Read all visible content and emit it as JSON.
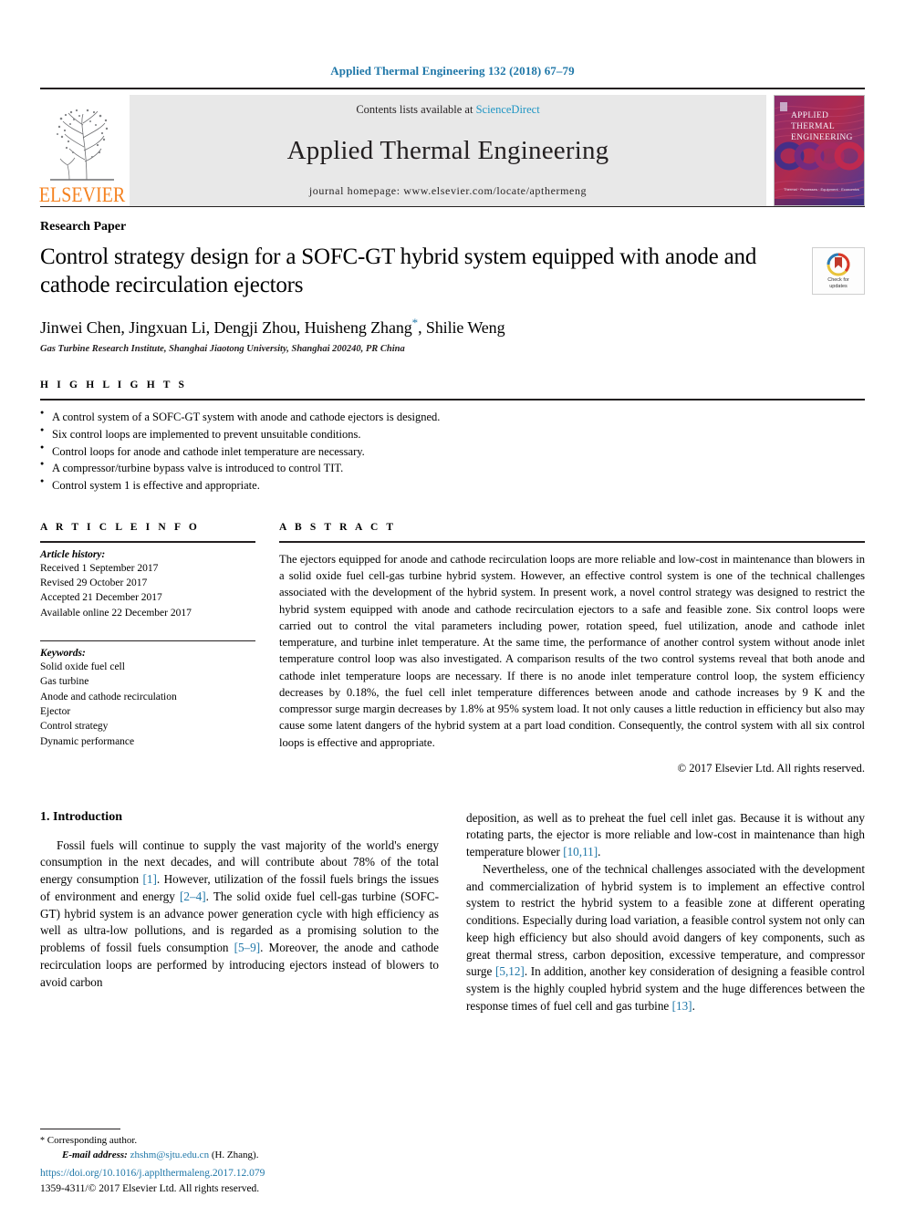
{
  "running_head": "Applied Thermal Engineering 132 (2018) 67–79",
  "masthead": {
    "publisher": "ELSEVIER",
    "contents_prefix": "Contents lists available at ",
    "contents_link": "ScienceDirect",
    "journal_title": "Applied Thermal Engineering",
    "homepage": "journal homepage: www.elsevier.com/locate/apthermeng",
    "cover_lines": [
      "APPLIED",
      "THERMAL",
      "ENGINEERING"
    ],
    "cover_footer": "Thermal · Processes · Equipment · Economics",
    "colors": {
      "link_blue": "#2196c4",
      "elsevier_orange": "#f58220",
      "band_gray": "#e8e8e8"
    }
  },
  "article": {
    "kind": "Research Paper",
    "title": "Control strategy design for a SOFC-GT hybrid system equipped with anode and cathode recirculation ejectors",
    "authors": "Jinwei Chen, Jingxuan Li, Dengji Zhou, Huisheng Zhang",
    "authors_tail": ", Shilie Weng",
    "corresponding_marker": "*",
    "affiliation": "Gas Turbine Research Institute, Shanghai Jiaotong University, Shanghai 200240, PR China",
    "crossmark": {
      "line1": "Check for",
      "line2": "updates"
    }
  },
  "highlights": {
    "heading": "H I G H L I G H T S",
    "items": [
      "A control system of a SOFC-GT system with anode and cathode ejectors is designed.",
      "Six control loops are implemented to prevent unsuitable conditions.",
      "Control loops for anode and cathode inlet temperature are necessary.",
      "A compressor/turbine bypass valve is introduced to control TIT.",
      "Control system 1 is effective and appropriate."
    ]
  },
  "article_info": {
    "heading": "A R T I C L E   I N F O",
    "history_label": "Article history:",
    "history": [
      "Received 1 September 2017",
      "Revised 29 October 2017",
      "Accepted 21 December 2017",
      "Available online 22 December 2017"
    ],
    "keywords_label": "Keywords:",
    "keywords": [
      "Solid oxide fuel cell",
      "Gas turbine",
      "Anode and cathode recirculation",
      "Ejector",
      "Control strategy",
      "Dynamic performance"
    ]
  },
  "abstract": {
    "heading": "A B S T R A C T",
    "text": "The ejectors equipped for anode and cathode recirculation loops are more reliable and low-cost in maintenance than blowers in a solid oxide fuel cell-gas turbine hybrid system. However, an effective control system is one of the technical challenges associated with the development of the hybrid system. In present work, a novel control strategy was designed to restrict the hybrid system equipped with anode and cathode recirculation ejectors to a safe and feasible zone. Six control loops were carried out to control the vital parameters including power, rotation speed, fuel utilization, anode and cathode inlet temperature, and turbine inlet temperature. At the same time, the performance of another control system without anode inlet temperature control loop was also investigated. A comparison results of the two control systems reveal that both anode and cathode inlet temperature loops are necessary. If there is no anode inlet temperature control loop, the system efficiency decreases by 0.18%, the fuel cell inlet temperature differences between anode and cathode increases by 9 K and the compressor surge margin decreases by 1.8% at 95% system load. It not only causes a little reduction in efficiency but also may cause some latent dangers of the hybrid system at a part load condition. Consequently, the control system with all six control loops is effective and appropriate.",
    "copyright": "© 2017 Elsevier Ltd. All rights reserved."
  },
  "introduction": {
    "section_number_title": "1. Introduction",
    "left_p1_a": "Fossil fuels will continue to supply the vast majority of the world's energy consumption in the next decades, and will contribute about 78% of the total energy consumption ",
    "left_ref1": "[1]",
    "left_p1_b": ". However, utilization of the fossil fuels brings the issues of environment and energy ",
    "left_ref2": "[2–4]",
    "left_p1_c": ". The solid oxide fuel cell-gas turbine (SOFC-GT) hybrid system is an advance power generation cycle with high efficiency as well as ultra-low pollutions, and is regarded as a promising solution to the problems of fossil fuels consumption ",
    "left_ref3": "[5–9]",
    "left_p1_d": ". Moreover, the anode and cathode recirculation loops are performed by introducing ejectors instead of blowers to avoid carbon",
    "right_p1_a": "deposition, as well as to preheat the fuel cell inlet gas. Because it is without any rotating parts, the ejector is more reliable and low-cost in maintenance than high temperature blower ",
    "right_ref1": "[10,11]",
    "right_p1_b": ".",
    "right_p2_a": "Nevertheless, one of the technical challenges associated with the development and commercialization of hybrid system is to implement an effective control system to restrict the hybrid system to a feasible zone at different operating conditions. Especially during load variation, a feasible control system not only can keep high efficiency but also should avoid dangers of key components, such as great thermal stress, carbon deposition, excessive temperature, and compressor surge ",
    "right_ref2": "[5,12]",
    "right_p2_b": ". In addition, another key consideration of designing a feasible control system is the highly coupled hybrid system and the huge differences between the response times of fuel cell and gas turbine ",
    "right_ref3": "[13]",
    "right_p2_c": "."
  },
  "footer": {
    "corresponding_star": "*",
    "corresponding_label": "Corresponding author.",
    "email_label": "E-mail address:",
    "email": "zhshm@sjtu.edu.cn",
    "email_owner": "(H. Zhang).",
    "doi": "https://doi.org/10.1016/j.applthermaleng.2017.12.079",
    "issn_line": "1359-4311/© 2017 Elsevier Ltd. All rights reserved."
  }
}
